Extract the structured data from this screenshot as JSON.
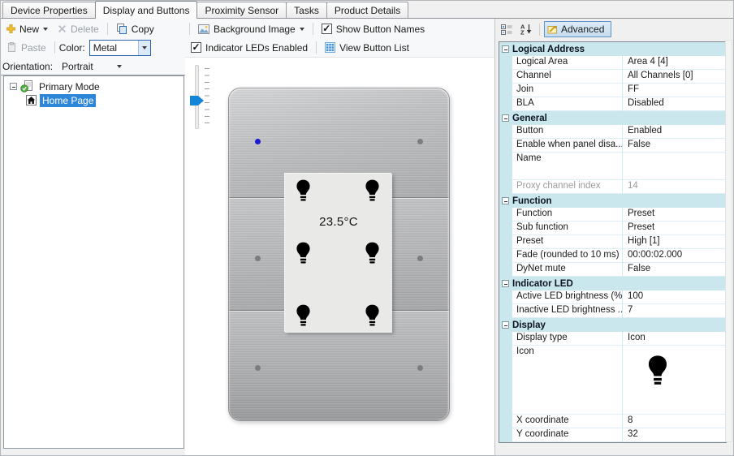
{
  "tabs": [
    {
      "label": "Device Properties",
      "active": false
    },
    {
      "label": "Display and Buttons",
      "active": true
    },
    {
      "label": "Proximity Sensor",
      "active": false
    },
    {
      "label": "Tasks",
      "active": false
    },
    {
      "label": "Product Details",
      "active": false
    }
  ],
  "left_toolbar": {
    "new_label": "New",
    "delete_label": "Delete",
    "copy_label": "Copy",
    "paste_label": "Paste",
    "color_label": "Color:",
    "color_value": "Metal",
    "orientation_label": "Orientation:",
    "orientation_value": "Portrait"
  },
  "tree": {
    "root_label": "Primary Mode",
    "page_label": "Home Page"
  },
  "center_toolbar": {
    "background_image_label": "Background Image",
    "show_button_names_label": "Show Button Names",
    "show_button_names_checked": true,
    "indicator_leds_label": "Indicator LEDs Enabled",
    "indicator_leds_checked": true,
    "view_button_list_label": "View Button List"
  },
  "preview": {
    "lcd_temperature": "23.5°C",
    "leds": [
      {
        "pos": "top-left",
        "state": "on",
        "color": "#1a1ad2"
      },
      {
        "pos": "top-right",
        "state": "off",
        "color": "#7d7d7d"
      },
      {
        "pos": "middle-left",
        "state": "off",
        "color": "#7d7d7d"
      },
      {
        "pos": "middle-right",
        "state": "off",
        "color": "#7d7d7d"
      },
      {
        "pos": "bottom-left",
        "state": "off",
        "color": "#7d7d7d"
      },
      {
        "pos": "bottom-right",
        "state": "off",
        "color": "#7d7d7d"
      }
    ]
  },
  "property_panel": {
    "advanced_label": "Advanced",
    "groups": [
      {
        "name": "Logical Address",
        "rows": [
          {
            "label": "Logical Area",
            "value": "Area 4 [4]"
          },
          {
            "label": "Channel",
            "value": "All Channels [0]"
          },
          {
            "label": "Join",
            "value": "FF"
          },
          {
            "label": "BLA",
            "value": "Disabled"
          }
        ]
      },
      {
        "name": "General",
        "rows": [
          {
            "label": "Button",
            "value": "Enabled"
          },
          {
            "label": "Enable when panel disa...",
            "value": "False"
          },
          {
            "label": "Name",
            "value": "",
            "tall": true
          },
          {
            "label": "Proxy channel index",
            "value": "14",
            "disabled": true
          }
        ]
      },
      {
        "name": "Function",
        "rows": [
          {
            "label": "Function",
            "value": "Preset"
          },
          {
            "label": "Sub function",
            "value": "Preset"
          },
          {
            "label": "Preset",
            "value": "High [1]"
          },
          {
            "label": "Fade (rounded to 10 ms)",
            "value": "00:00:02.000"
          },
          {
            "label": "DyNet mute",
            "value": "False"
          }
        ]
      },
      {
        "name": "Indicator LED",
        "rows": [
          {
            "label": "Active LED brightness (%)",
            "value": "100"
          },
          {
            "label": "Inactive LED brightness ...",
            "value": "7"
          }
        ]
      },
      {
        "name": "Display",
        "rows": [
          {
            "label": "Display type",
            "value": "Icon"
          },
          {
            "label": "Icon",
            "value": "",
            "icon": true
          },
          {
            "label": "X coordinate",
            "value": "8"
          },
          {
            "label": "Y coordinate",
            "value": "32"
          }
        ]
      }
    ]
  },
  "colors": {
    "selection_blue": "#2e86d9",
    "category_bg": "#cbe7ee",
    "led_active": "#1a1ad2",
    "led_inactive": "#7d7d7d",
    "panel_metal": "#b4b5b7"
  }
}
